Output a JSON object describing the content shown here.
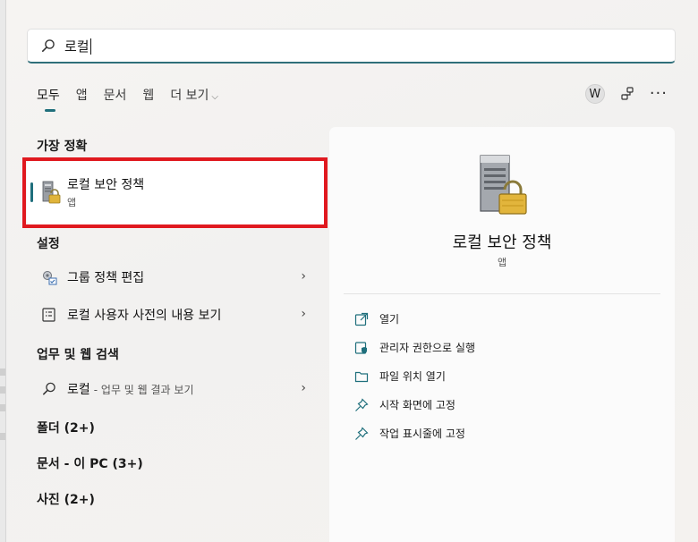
{
  "search": {
    "query": "로컬"
  },
  "tabs": [
    {
      "label": "모두",
      "active": true
    },
    {
      "label": "앱"
    },
    {
      "label": "문서"
    },
    {
      "label": "웹"
    },
    {
      "label": "더 보기"
    }
  ],
  "top_icons": {
    "avatar_letter": "W"
  },
  "best_match": {
    "heading": "가장 정확",
    "name": "로컬 보안 정책",
    "type": "앱"
  },
  "settings": {
    "heading": "설정",
    "items": [
      {
        "label": "그룹 정책 편집",
        "icon": "group-policy-icon"
      },
      {
        "label": "로컬 사용자 사전의 내용 보기",
        "icon": "dictionary-icon"
      }
    ]
  },
  "web": {
    "heading": "업무 및 웹 검색",
    "query": "로컬",
    "hint": "- 업무 및 웹 결과 보기"
  },
  "groups": [
    {
      "label": "폴더 (2+)"
    },
    {
      "label": "문서 - 이 PC (3+)"
    },
    {
      "label": "사진 (2+)"
    }
  ],
  "detail": {
    "title": "로컬 보안 정책",
    "type": "앱",
    "actions": [
      {
        "label": "열기",
        "icon": "open-icon"
      },
      {
        "label": "관리자 권한으로 실행",
        "icon": "run-as-admin-icon"
      },
      {
        "label": "파일 위치 열기",
        "icon": "folder-icon"
      },
      {
        "label": "시작 화면에 고정",
        "icon": "pin-icon"
      },
      {
        "label": "작업 표시줄에 고정",
        "icon": "pin-icon"
      }
    ]
  },
  "colors": {
    "accent": "#1f6f7c",
    "highlight": "#e0191f"
  }
}
